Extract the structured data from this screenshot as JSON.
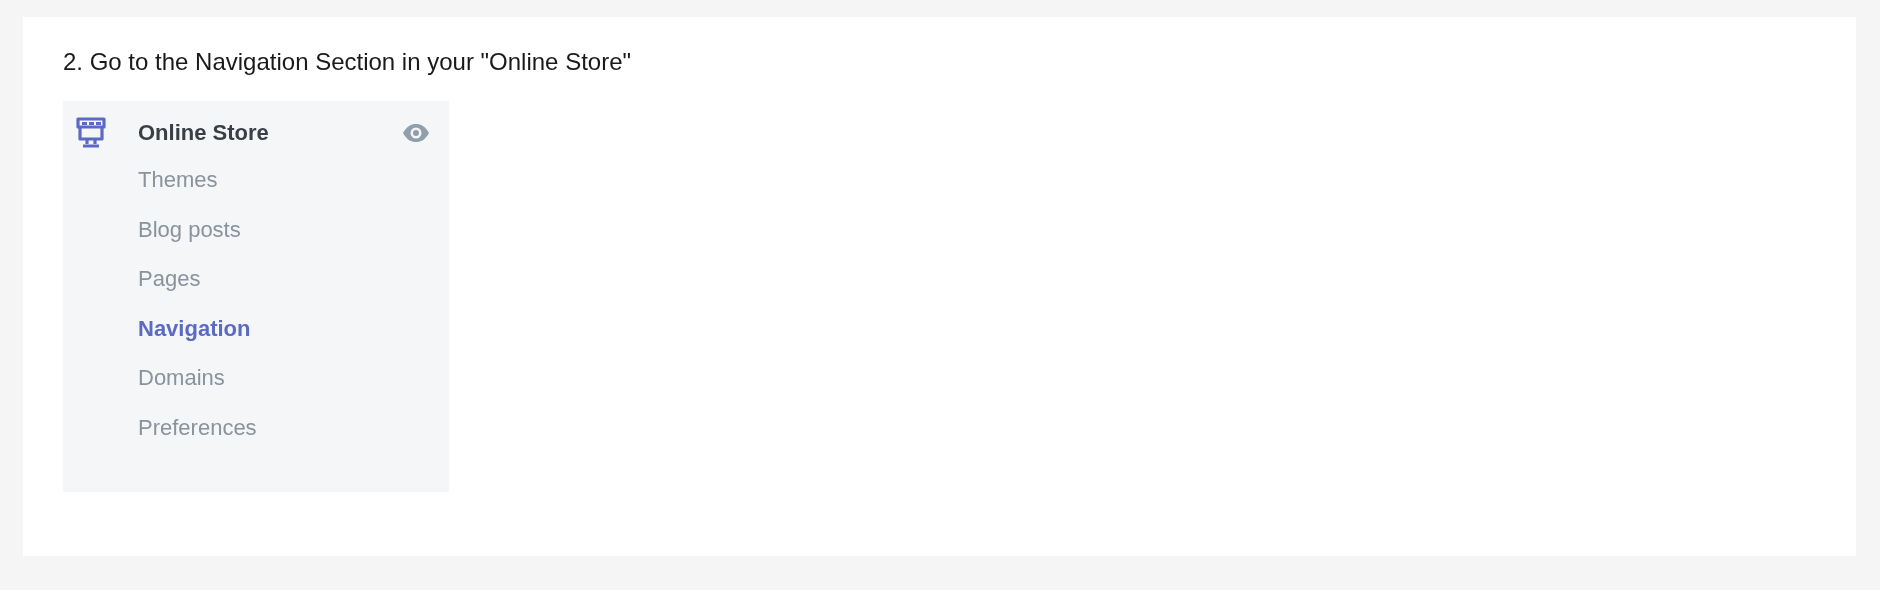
{
  "step": {
    "text": "2. Go to the Navigation Section in your \"Online Store\""
  },
  "sidebar": {
    "title": "Online Store",
    "items": [
      {
        "label": "Themes",
        "selected": false
      },
      {
        "label": "Blog posts",
        "selected": false
      },
      {
        "label": "Pages",
        "selected": false
      },
      {
        "label": "Navigation",
        "selected": true
      },
      {
        "label": "Domains",
        "selected": false
      },
      {
        "label": "Preferences",
        "selected": false
      }
    ]
  }
}
